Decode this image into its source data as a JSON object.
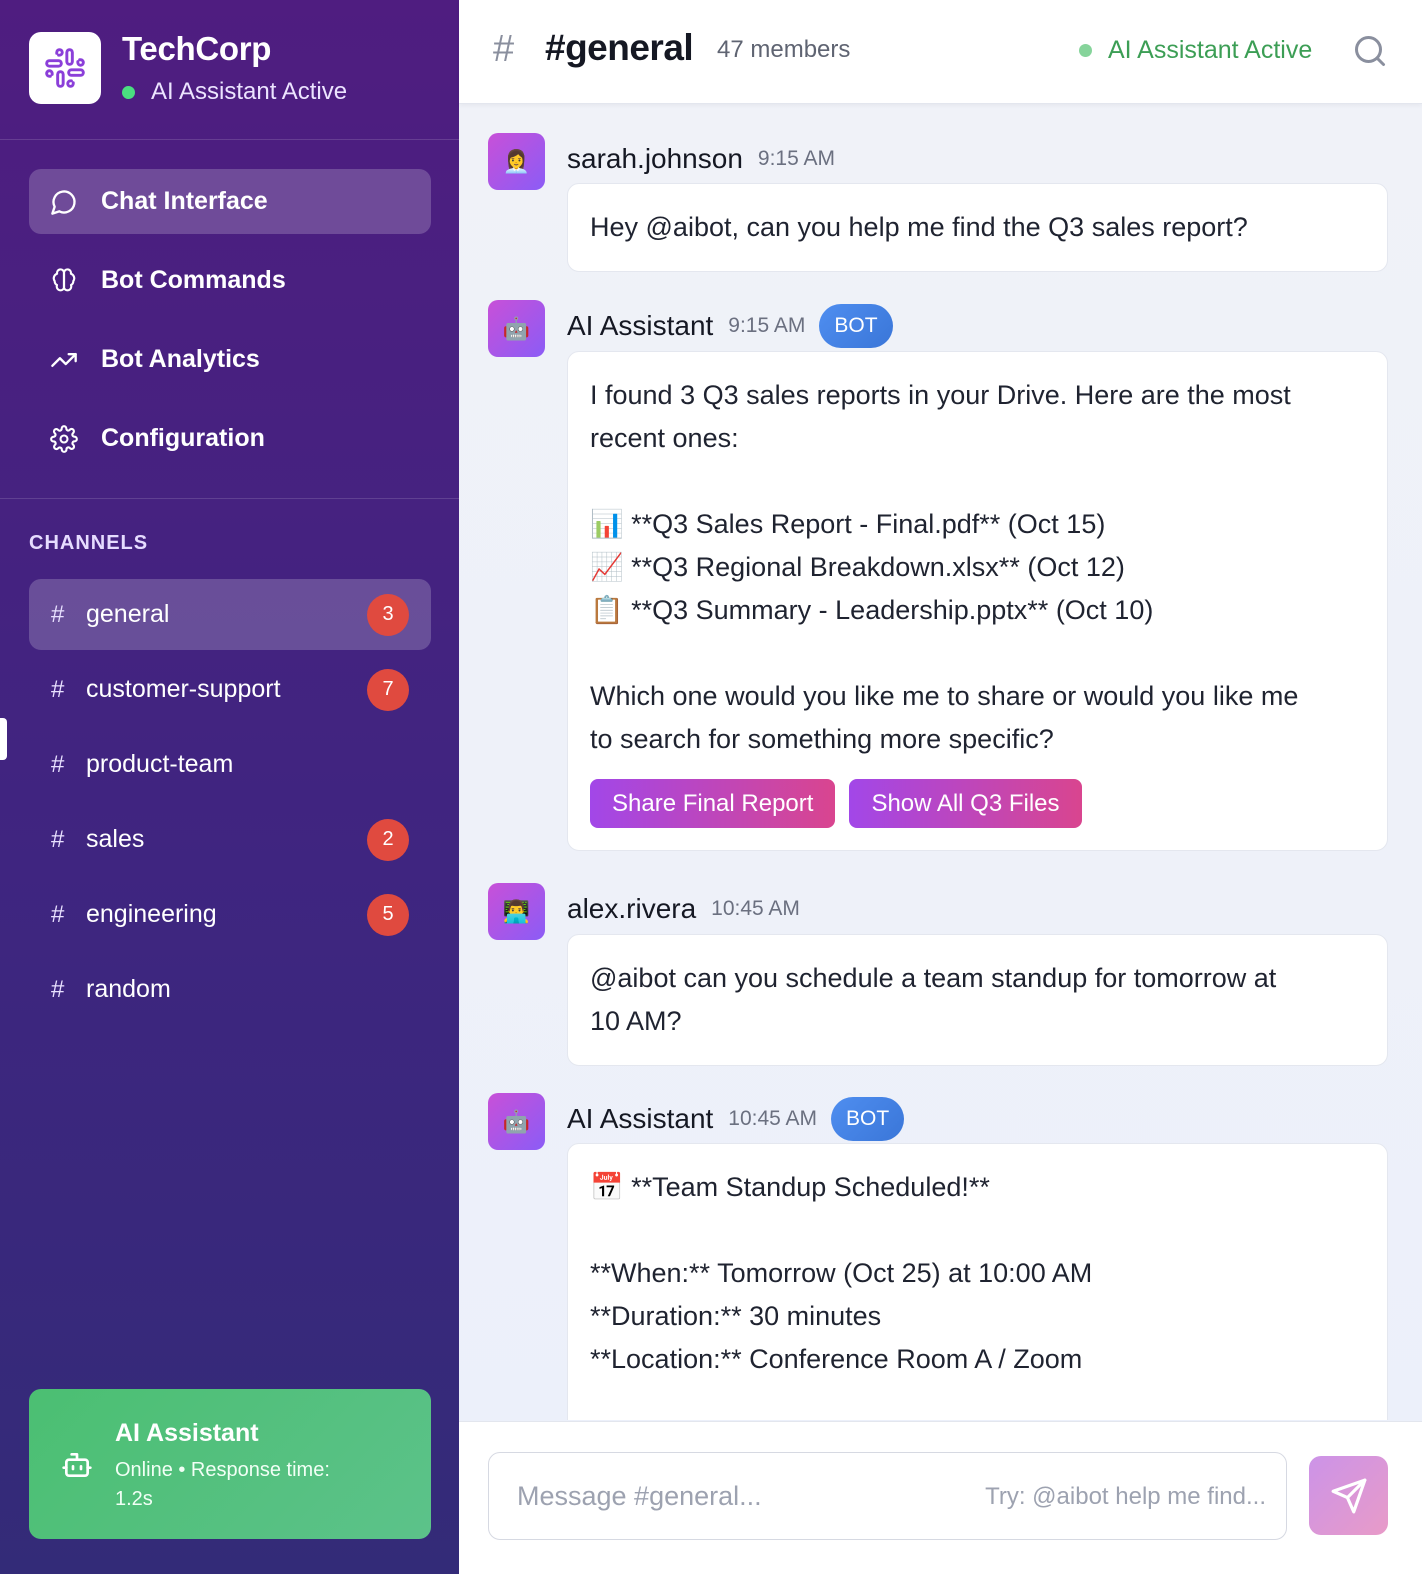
{
  "brand": {
    "name": "TechCorp",
    "status": "AI Assistant Active"
  },
  "nav": {
    "items": [
      {
        "label": "Chat Interface",
        "icon": "chat-bubble-icon",
        "active": true
      },
      {
        "label": "Bot Commands",
        "icon": "brain-icon",
        "active": false
      },
      {
        "label": "Bot Analytics",
        "icon": "trending-up-icon",
        "active": false
      },
      {
        "label": "Configuration",
        "icon": "gear-icon",
        "active": false
      }
    ]
  },
  "channels": {
    "title": "CHANNELS",
    "items": [
      {
        "name": "general",
        "badge": "3",
        "active": true
      },
      {
        "name": "customer-support",
        "badge": "7",
        "active": false
      },
      {
        "name": "product-team",
        "badge": "",
        "active": false
      },
      {
        "name": "sales",
        "badge": "2",
        "active": false
      },
      {
        "name": "engineering",
        "badge": "5",
        "active": false
      },
      {
        "name": "random",
        "badge": "",
        "active": false
      }
    ]
  },
  "assistant_card": {
    "title": "AI Assistant",
    "status_line1": "Online • Response time:",
    "status_line2": "1.2s"
  },
  "header": {
    "hash": "#",
    "channel": "#general",
    "members": "47 members",
    "status": "AI Assistant Active"
  },
  "messages": [
    {
      "author": "sarah.johnson",
      "time": "9:15 AM",
      "avatar": "👩‍💼",
      "bot": false,
      "lines": [
        "Hey @aibot, can you help me find the Q3 sales report?"
      ]
    },
    {
      "author": "AI Assistant",
      "time": "9:15 AM",
      "avatar": "🤖",
      "bot": true,
      "badge": "BOT",
      "lines": [
        "I found 3 Q3 sales reports in your Drive. Here are the most",
        "recent ones:",
        "",
        "📊 **Q3 Sales Report - Final.pdf** (Oct 15)",
        "📈 **Q3 Regional Breakdown.xlsx** (Oct 12)",
        "📋 **Q3 Summary - Leadership.pptx** (Oct 10)",
        "",
        "Which one would you like me to share or would you like me",
        "to search for something more specific?"
      ],
      "actions": [
        "Share Final Report",
        "Show All Q3 Files"
      ]
    },
    {
      "author": "alex.rivera",
      "time": "10:45 AM",
      "avatar": "👨‍💻",
      "bot": false,
      "lines": [
        "@aibot can you schedule a team standup for tomorrow at",
        "10 AM?"
      ]
    },
    {
      "author": "AI Assistant",
      "time": "10:45 AM",
      "avatar": "🤖",
      "bot": true,
      "badge": "BOT",
      "lines": [
        "📅 **Team Standup Scheduled!**",
        "",
        "**When:** Tomorrow (Oct 25) at 10:00 AM",
        "**Duration:** 30 minutes",
        "**Location:** Conference Room A / Zoom"
      ]
    }
  ],
  "composer": {
    "placeholder": "Message #general...",
    "hint": "Try: @aibot help me find..."
  },
  "colors": {
    "sidebar_top": "#4f1d80",
    "accent_green": "#3c9e55",
    "badge_red": "#e04a3f",
    "bot_badge_blue": "#3a76d8"
  }
}
